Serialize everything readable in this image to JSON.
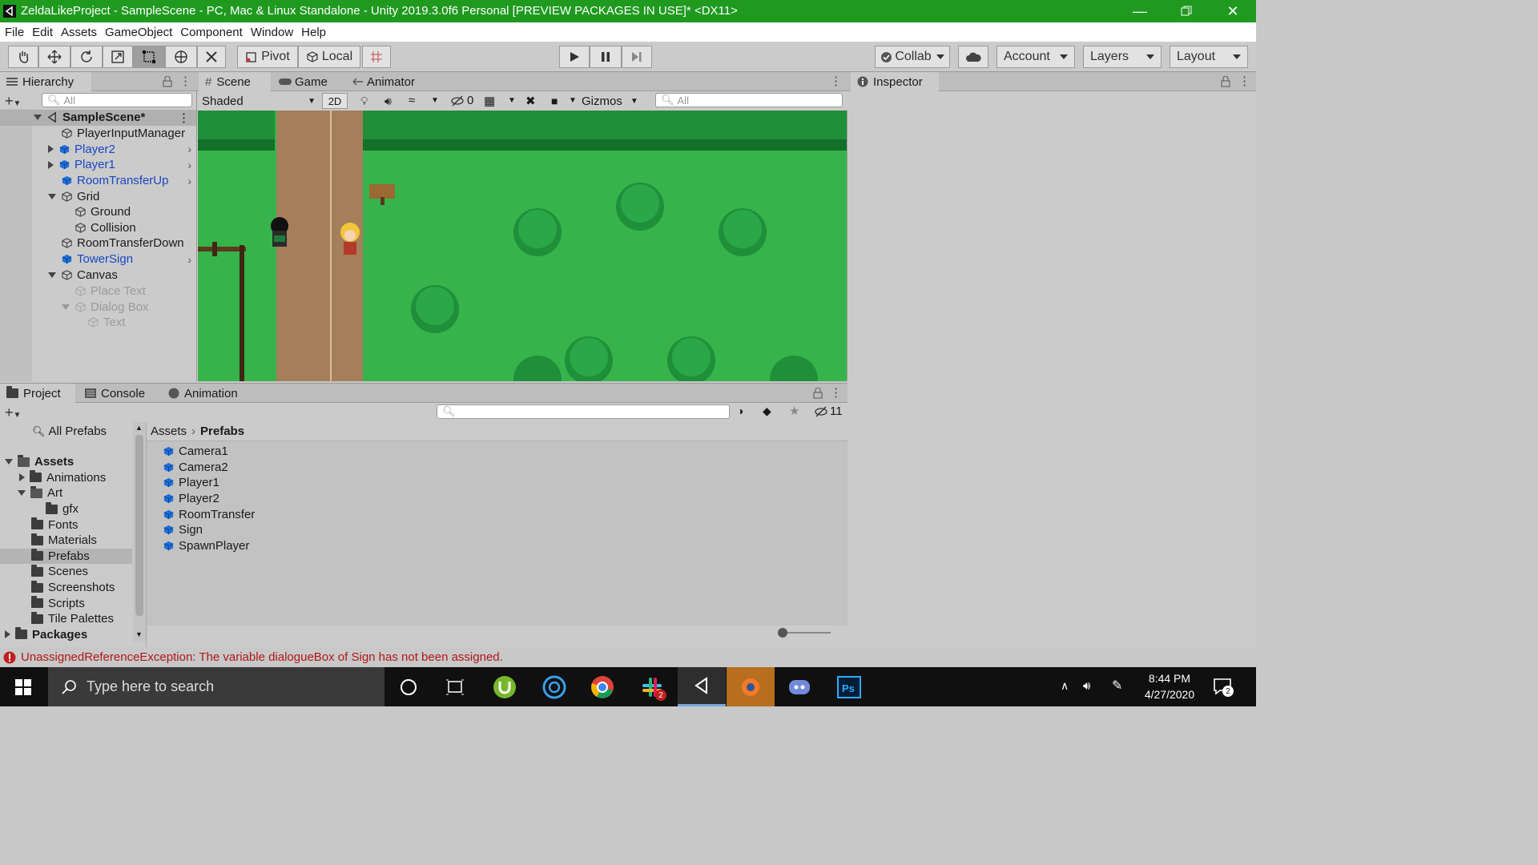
{
  "window": {
    "title": "ZeldaLikeProject - SampleScene - PC, Mac & Linux Standalone - Unity 2019.3.0f6 Personal [PREVIEW PACKAGES IN USE]* <DX11>"
  },
  "menu": [
    "File",
    "Edit",
    "Assets",
    "GameObject",
    "Component",
    "Window",
    "Help"
  ],
  "toolbar": {
    "pivot_label": "Pivot",
    "local_label": "Local",
    "collab_label": "Collab",
    "account_label": "Account",
    "layers_label": "Layers",
    "layout_label": "Layout"
  },
  "hierarchy": {
    "tab": "Hierarchy",
    "search_placeholder": "All",
    "scene_name": "SampleScene*",
    "items": [
      {
        "label": "PlayerInputManager"
      },
      {
        "label": "Player2"
      },
      {
        "label": "Player1"
      },
      {
        "label": "RoomTransferUp"
      },
      {
        "label": "Grid"
      },
      {
        "label": "Ground"
      },
      {
        "label": "Collision"
      },
      {
        "label": "RoomTransferDown"
      },
      {
        "label": "TowerSign"
      },
      {
        "label": "Canvas"
      },
      {
        "label": "Place Text"
      },
      {
        "label": "Dialog Box"
      },
      {
        "label": "Text"
      }
    ]
  },
  "scene": {
    "tabs": [
      "Scene",
      "Game",
      "Animator"
    ],
    "shading_mode": "Shaded",
    "mode_2d": "2D",
    "hidden_count": "0",
    "gizmos_label": "Gizmos",
    "search_placeholder": "All"
  },
  "inspector": {
    "tab": "Inspector"
  },
  "project": {
    "tabs": [
      "Project",
      "Console",
      "Animation"
    ],
    "hidden_count": "11",
    "all_prefabs": "All Prefabs",
    "tree": [
      {
        "label": "Assets"
      },
      {
        "label": "Animations"
      },
      {
        "label": "Art"
      },
      {
        "label": "gfx"
      },
      {
        "label": "Fonts"
      },
      {
        "label": "Materials"
      },
      {
        "label": "Prefabs"
      },
      {
        "label": "Scenes"
      },
      {
        "label": "Screenshots"
      },
      {
        "label": "Scripts"
      },
      {
        "label": "Tile Palettes"
      },
      {
        "label": "Packages"
      }
    ],
    "breadcrumb": [
      "Assets",
      "Prefabs"
    ],
    "assets": [
      "Camera1",
      "Camera2",
      "Player1",
      "Player2",
      "RoomTransfer",
      "Sign",
      "SpawnPlayer"
    ]
  },
  "status": {
    "error_message": "UnassignedReferenceException: The variable dialogueBox of Sign has not been assigned."
  },
  "taskbar": {
    "search_placeholder": "Type here to search",
    "time": "8:44 PM",
    "date": "4/27/2020",
    "slack_badge": "2",
    "notification_badge": "2"
  },
  "colors": {
    "title_bar": "#1f9a1f",
    "grass": "#36b34a",
    "dirt_path": "#a57e5a",
    "error_text": "#b01717",
    "prefab_blue": "#1947c4"
  }
}
